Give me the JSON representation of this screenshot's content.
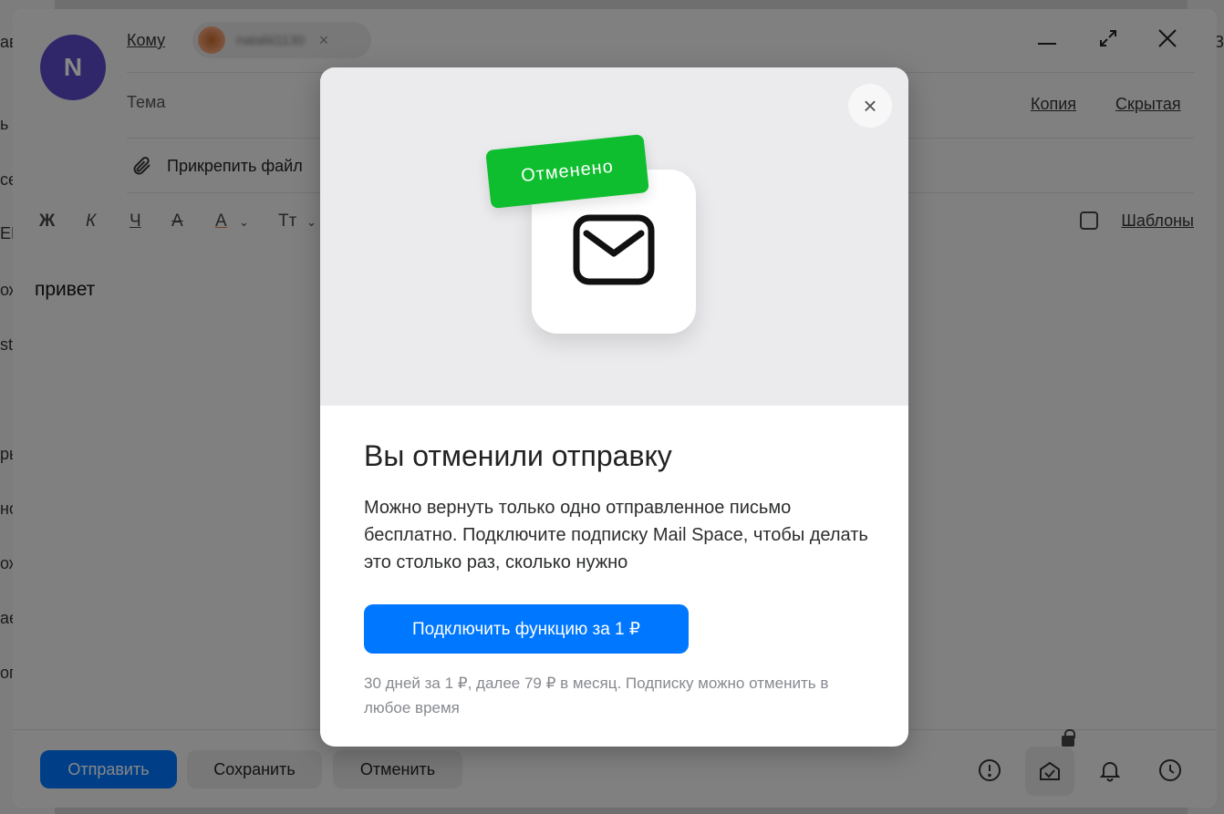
{
  "background": {
    "left_fragments": [
      "ав",
      "ь",
      "се",
      "EF",
      "ож",
      "st",
      "ры",
      "но",
      "ож",
      "ае",
      "ог"
    ],
    "right_fragments": [
      "З"
    ]
  },
  "composer": {
    "avatar_letter": "N",
    "to_label": "Кому",
    "recipient_name": "nataliii1130",
    "chip_close": "×",
    "subject_label": "Тема",
    "cc_label": "Копия",
    "bcc_label": "Скрытая",
    "attach_label": "Прикрепить файл",
    "format": {
      "bold": "Ж",
      "italic": "К",
      "underline": "Ч",
      "strike": "А",
      "color": "А",
      "size": "Тт"
    },
    "templates_label": "Шаблоны",
    "body_text": "привет",
    "footer": {
      "send_label": "Отправить",
      "save_label": "Сохранить",
      "cancel_label": "Отменить"
    }
  },
  "modal": {
    "stamp_text": "Отменено",
    "title": "Вы отменили отправку",
    "description": "Можно вернуть только одно отправленное письмо бесплатно. Подключите подписку Mail Space, чтобы делать это столько раз, сколько нужно",
    "cta_label": "Подключить функцию за 1 ₽",
    "note": "30 дней за 1 ₽, далее 79 ₽ в месяц. Подписку можно отменить в любое время",
    "close_symbol": "×"
  },
  "colors": {
    "primary": "#0077ff",
    "stamp": "#0fbe2e",
    "avatar": "#5b4ac9"
  }
}
